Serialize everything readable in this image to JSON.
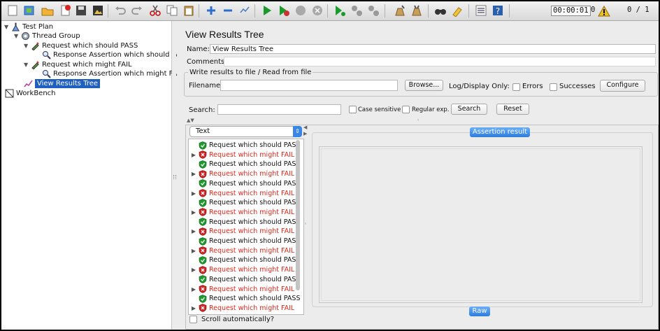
{
  "toolbar": {
    "timer": "00:00:01",
    "warning_count": "0",
    "threads": "0 / 1"
  },
  "tree": {
    "nodes": [
      {
        "label": "Test Plan"
      },
      {
        "label": "Thread Group"
      },
      {
        "label": "Request which should PASS"
      },
      {
        "label": "Response Assertion which should PASS"
      },
      {
        "label": "Request which might FAIL"
      },
      {
        "label": "Response Assertion which might FAIL"
      },
      {
        "label": "View Results Tree"
      },
      {
        "label": "WorkBench"
      }
    ]
  },
  "panel": {
    "title": "View Results Tree",
    "name_label": "Name:",
    "name_value": "View Results Tree",
    "comments_label": "Comments:",
    "fieldset_legend": "Write results to file / Read from file",
    "filename_label": "Filename",
    "browse_label": "Browse...",
    "log_display_label": "Log/Display Only:",
    "errors_label": "Errors",
    "successes_label": "Successes",
    "configure_label": "Configure",
    "search_label": "Search:",
    "case_sensitive_label": "Case sensitive",
    "regex_label": "Regular exp.",
    "search_button": "Search",
    "reset_button": "Reset",
    "renderer_selected": "Text",
    "assertion_tab": "Assertion result",
    "raw_tab": "Raw",
    "scroll_auto_label": "Scroll automatically?"
  },
  "results": [
    {
      "label": "Request which should PASS",
      "status": "pass"
    },
    {
      "label": "Request which might FAIL",
      "status": "fail"
    },
    {
      "label": "Request which should PASS",
      "status": "pass"
    },
    {
      "label": "Request which might FAIL",
      "status": "fail"
    },
    {
      "label": "Request which should PASS",
      "status": "pass"
    },
    {
      "label": "Request which might FAIL",
      "status": "fail"
    },
    {
      "label": "Request which should PASS",
      "status": "pass"
    },
    {
      "label": "Request which might FAIL",
      "status": "fail"
    },
    {
      "label": "Request which should PASS",
      "status": "pass"
    },
    {
      "label": "Request which might FAIL",
      "status": "fail"
    },
    {
      "label": "Request which should PASS",
      "status": "pass"
    },
    {
      "label": "Request which might FAIL",
      "status": "fail"
    },
    {
      "label": "Request which should PASS",
      "status": "pass"
    },
    {
      "label": "Request which might FAIL",
      "status": "fail"
    },
    {
      "label": "Request which should PASS",
      "status": "pass"
    },
    {
      "label": "Request which might FAIL",
      "status": "fail"
    },
    {
      "label": "Request which should PASS",
      "status": "pass"
    },
    {
      "label": "Request which might FAIL",
      "status": "fail"
    }
  ],
  "colors": {
    "fail_text": "#e0261a",
    "selection": "#1f5fbf",
    "accent_tab": "#2d7ce0",
    "pass_icon": "#1f9a2e"
  }
}
